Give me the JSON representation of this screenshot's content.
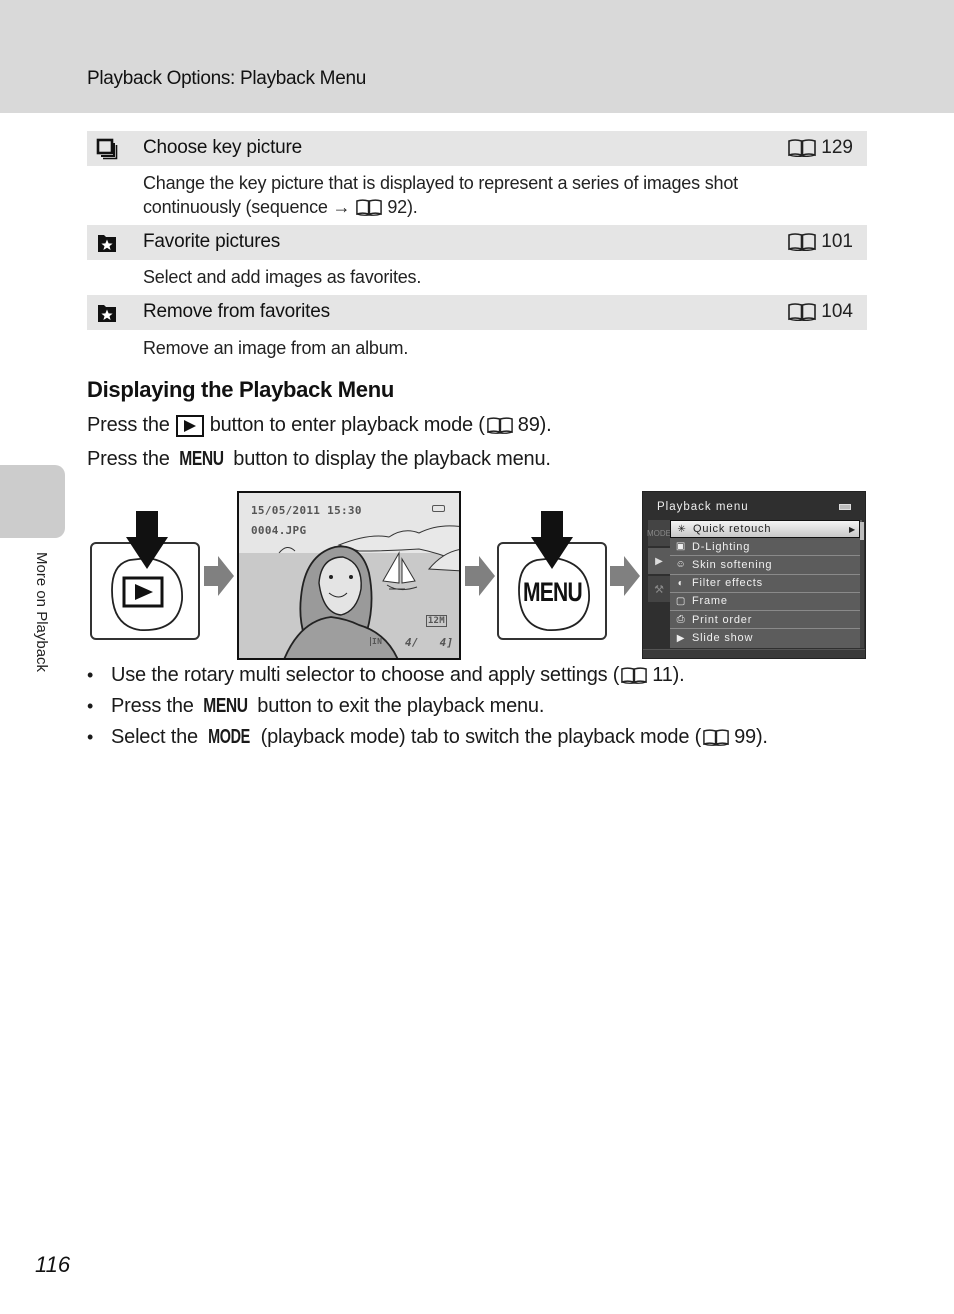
{
  "header": {
    "title": "Playback Options: Playback Menu"
  },
  "side_tab": {
    "label": "More on Playback"
  },
  "options": [
    {
      "icon": "choose-key-picture-icon",
      "label": "Choose key picture",
      "ref": "129",
      "desc_line1": "Change the key picture that is displayed to represent a series of images shot",
      "desc_line2_prefix": "continuously (sequence →",
      "desc_line2_ref": "92",
      "desc_line2_suffix": ")."
    },
    {
      "icon": "favorite-pictures-icon",
      "label": "Favorite pictures",
      "ref": "101",
      "desc": "Select and add images as favorites."
    },
    {
      "icon": "remove-from-favorites-icon",
      "label": "Remove from favorites",
      "ref": "104",
      "desc": "Remove an image from an album."
    }
  ],
  "section": {
    "title": "Displaying the Playback Menu",
    "step1": {
      "prefix": "Press the",
      "suffix": "button to enter playback mode (",
      "ref": "89",
      "end": ")."
    },
    "step2": {
      "prefix": "Press the",
      "glyph": "MENU",
      "suffix": "button to display the playback menu."
    }
  },
  "figure": {
    "menu_button_label": "MENU",
    "playback_screen": {
      "datetime": "15/05/2011 15:30",
      "filename": "0004.JPG",
      "image_size": "12M",
      "memory": "IN",
      "counter": "4/   4]"
    },
    "playback_menu": {
      "title": "Playback menu",
      "tabs": [
        "MODE",
        "▶",
        "⚒"
      ],
      "items": [
        {
          "icon": "✳",
          "label": "Quick retouch",
          "selected": true
        },
        {
          "icon": "▣",
          "label": "D-Lighting",
          "selected": false
        },
        {
          "icon": "☺",
          "label": "Skin softening",
          "selected": false
        },
        {
          "icon": "◐",
          "label": "Filter effects",
          "selected": false
        },
        {
          "icon": "▢",
          "label": "Frame",
          "selected": false
        },
        {
          "icon": "⎙",
          "label": "Print order",
          "selected": false
        },
        {
          "icon": "▶",
          "label": "Slide show",
          "selected": false
        }
      ]
    }
  },
  "bullets": [
    {
      "prefix": "Use the rotary multi selector to choose and apply settings (",
      "ref": "11",
      "suffix": ")."
    },
    {
      "prefix": "Press the",
      "glyph": "MENU",
      "suffix": "button to exit the playback menu."
    },
    {
      "prefix": "Select the",
      "glyph": "MODE",
      "suffix": "(playback mode) tab to switch the playback mode (",
      "ref": "99",
      "end": ")."
    }
  ],
  "bullet_symbol": "•",
  "page_number": "116"
}
